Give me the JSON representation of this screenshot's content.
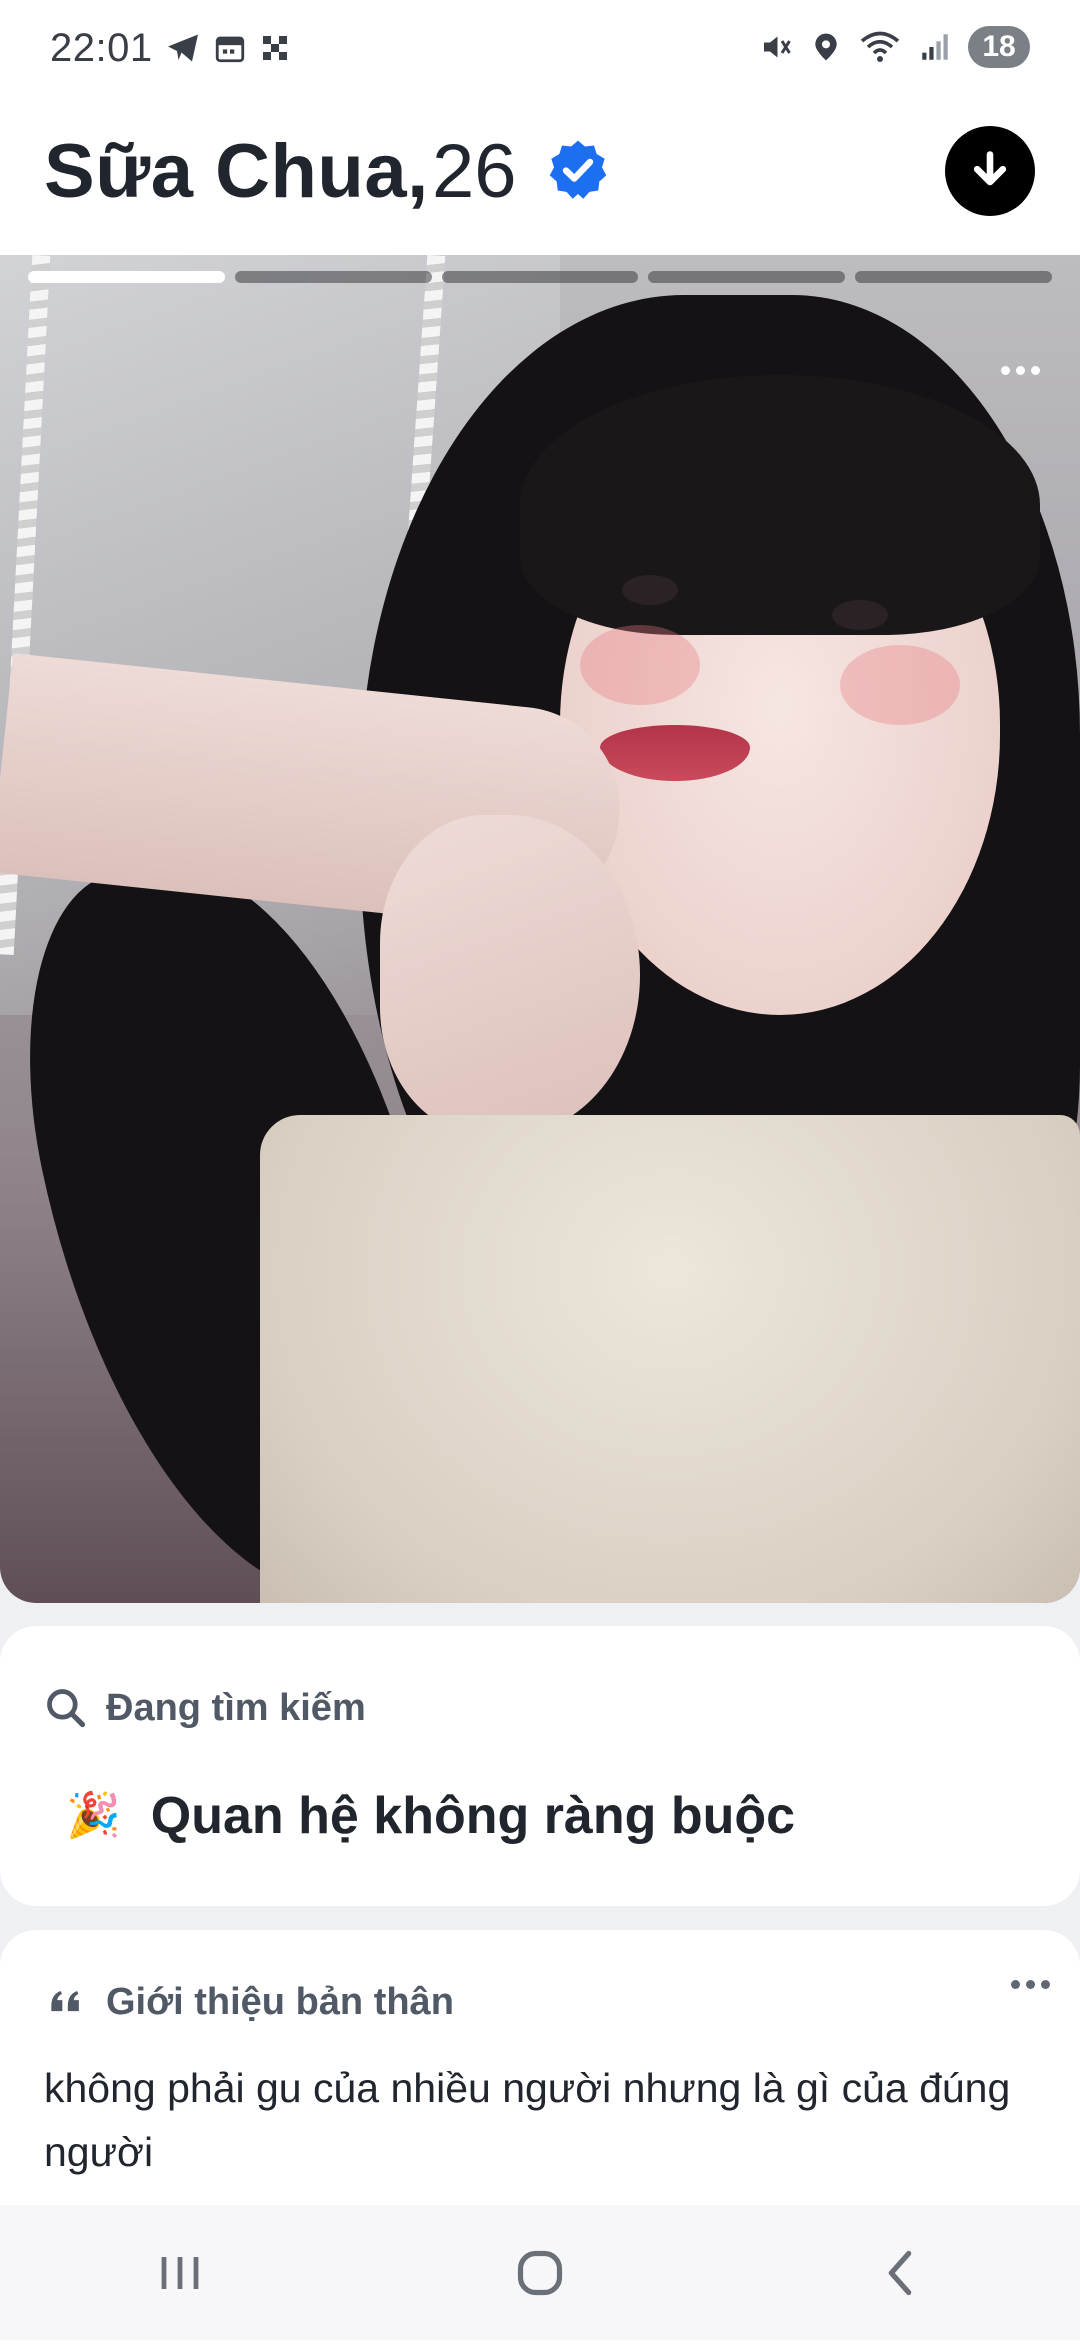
{
  "status_bar": {
    "time": "22:01",
    "battery": "18",
    "left_icons": [
      "telegram-icon",
      "calendar-icon",
      "app-grid-icon"
    ],
    "right_icons": [
      "mute-icon",
      "location-icon",
      "wifi-icon",
      "signal-icon"
    ]
  },
  "profile": {
    "name": "Sữa Chua,",
    "age": "26",
    "verified": true
  },
  "photo": {
    "segments": 5,
    "active_segment": 1
  },
  "looking_for": {
    "label": "Đang tìm kiếm",
    "emoji": "🎉",
    "value": "Quan hệ không ràng buộc"
  },
  "about": {
    "label": "Giới thiệu bản thân",
    "text": "không phải gu của nhiều người nhưng là gì của đúng người"
  },
  "colors": {
    "accent_verified": "#1d6ff2",
    "text_primary": "#21262e",
    "label_gray": "#505965"
  },
  "nav": [
    "recent-apps-icon",
    "home-icon",
    "back-icon"
  ]
}
